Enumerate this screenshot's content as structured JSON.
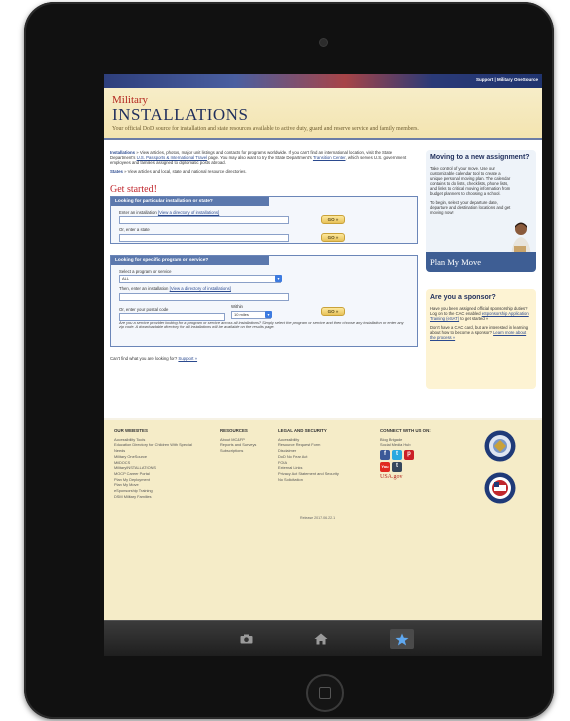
{
  "topbar": {
    "links": "Support | Military OneSource"
  },
  "masthead": {
    "title_line1": "Military",
    "title_line2": "INSTALLATIONS",
    "tagline": "Your official DoD source for installation and state resources available to active duty, guard and reserve service and family members."
  },
  "intro": {
    "installations_label": "Installations",
    "installations_text": " » View articles, photos, major unit listings and contacts for programs worldwide. If you can't find an international location, visit the State Department's ",
    "passports_link": "U.S. Passports & International Travel",
    "page_text": " page. You may also want to try the State Department's ",
    "transition_link": "Transition Center",
    "transition_text": ", which serves U.S. government employees and families assigned to diplomatic posts abroad.",
    "states_label": "States",
    "states_text": " » View articles and local, state and national resource directories."
  },
  "get_started": "Get started!",
  "panel1": {
    "header": "Looking for particular installation or state?",
    "enter_installation": "Enter an installation ",
    "directory_link": "[View a directory of installations]",
    "or_state": "Or, enter a state",
    "go_label": "GO »"
  },
  "panel2": {
    "header": "Looking for specific program or service?",
    "select_program": "Select a program or service",
    "program_value": "ALL",
    "then_installation": "Then, enter an installation ",
    "directory_link": "[View a directory of installations]",
    "or_postal": "Or, enter your postal code",
    "within": "Within",
    "miles_value": "10 miles",
    "go_label": "GO »",
    "note": "Are you a service provider looking for a program or service across all installations? Simply select the program or service and then choose any installation or enter any zip code. A downloadable directory for all installations will be available on the results page."
  },
  "cant_find": "Can't find what you are looking for? ",
  "support_link": "Support »",
  "promo_move": {
    "title": "Moving to a new assignment?",
    "text1": "Take control of your move. Use our customizable calendar tool to create a unique personal moving plan. The calendar contains to do lists, checklists, phone lists, and links to critical moving information from budget planners to choosing a school.",
    "text2": "To begin, select your departure date, departure and destination locations and get moving now!",
    "banner": "Plan My Move"
  },
  "promo_sponsor": {
    "title": "Are you a sponsor?",
    "text1": "Have you been assigned official sponsorship duties? Log on to the CAC enabled ",
    "link1": "eSponsorship Application Training (eSAT)",
    "text1b": " to get started »",
    "text2": "Don't have a CAC card, but are interested in learning about how to become a sponsor? ",
    "link2": "Learn more about the process »"
  },
  "footer": {
    "websites": {
      "heading": "OUR WEBSITES",
      "items": [
        "Accessibility Tools",
        "Education Directory for Children With Special Needs",
        "Military OneSource",
        "MilDOCS",
        "MilitaryINSTALLATIONS",
        "MOCP Career Portal",
        "Plan My Deployment",
        "Plan My Move",
        "eSponsorship Training",
        "DSM Military Families"
      ]
    },
    "resources": {
      "heading": "RESOURCES",
      "items": [
        "About MC&FP",
        "Reports and Surveys",
        "Subscriptions"
      ]
    },
    "legal": {
      "heading": "LEGAL AND SECURITY",
      "items": [
        "Accessibility",
        "Resource Request Form",
        "Disclaimer",
        "DoD No Fear Act",
        "FOIA",
        "External Links",
        "Privacy Act Statement and Security",
        "No Solicitation"
      ]
    },
    "connect": {
      "heading": "CONNECT WITH US ON:",
      "items": [
        "Blog Brigade",
        "Social Media Hub"
      ],
      "usagov": "USA.gov"
    },
    "version": "Release 2017.06.22.1"
  },
  "toolbar": {
    "icons": [
      "camera-icon",
      "home-icon",
      "star-icon"
    ]
  },
  "colors": {
    "accent_red": "#c0272d",
    "navy": "#1f2e5c",
    "panel_blue": "#5b78ad",
    "footer_bg": "#f5ecc8"
  }
}
